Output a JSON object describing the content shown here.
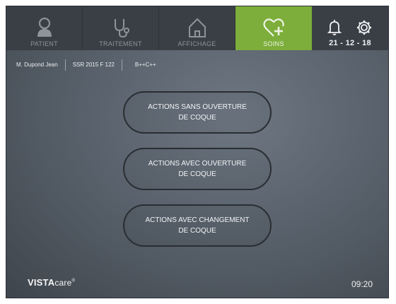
{
  "tabs": [
    {
      "label": "PATIENT",
      "icon": "patient-icon",
      "active": false
    },
    {
      "label": "TRAITEMENT",
      "icon": "stethoscope-icon",
      "active": false
    },
    {
      "label": "AFFICHAGE",
      "icon": "home-icon",
      "active": false
    },
    {
      "label": "SOINS",
      "icon": "heart-plus-icon",
      "active": true
    }
  ],
  "header": {
    "date": "21 - 12 - 18"
  },
  "patient_info": {
    "name": "M. Dupond Jean",
    "room": "SSR 2015 F 122",
    "code": "B++C++"
  },
  "actions": [
    {
      "line1": "ACTIONS SANS OUVERTURE",
      "line2": "DE COQUE"
    },
    {
      "line1": "ACTIONS AVEC OUVERTURE",
      "line2": "DE COQUE"
    },
    {
      "line1": "ACTIONS AVEC CHANGEMENT",
      "line2": "DE COQUE"
    }
  ],
  "footer": {
    "brand_vista": "VISTA",
    "brand_care": "care",
    "brand_mark": "®",
    "time": "09:20"
  },
  "colors": {
    "accent": "#7dae3b",
    "topbar": "#3a3f46"
  }
}
